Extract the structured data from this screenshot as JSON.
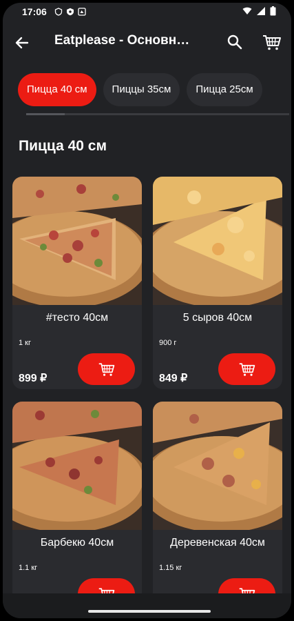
{
  "status_bar": {
    "time": "17:06"
  },
  "app_bar": {
    "title": "Eatplease - Основное меню"
  },
  "tabs": [
    {
      "label": "Пицца 40 см",
      "active": true
    },
    {
      "label": "Пиццы 35см",
      "active": false
    },
    {
      "label": "Пицца 25см",
      "active": false
    }
  ],
  "section": {
    "title": "Пицца 40 см"
  },
  "products": [
    {
      "name": "#тесто 40см",
      "weight": "1 кг",
      "price": "899 ₽"
    },
    {
      "name": "5 сыров 40см",
      "weight": "900 г",
      "price": "849 ₽"
    },
    {
      "name": "Барбекю 40см",
      "weight": "1.1 кг",
      "price": ""
    },
    {
      "name": "Деревенская 40см",
      "weight": "1.15 кг",
      "price": ""
    }
  ],
  "colors": {
    "accent": "#ec1c13",
    "background": "#212225",
    "card": "#2a2b2f"
  },
  "icons": [
    "back-arrow-icon",
    "search-icon",
    "cart-icon",
    "add-to-cart-icon"
  ]
}
